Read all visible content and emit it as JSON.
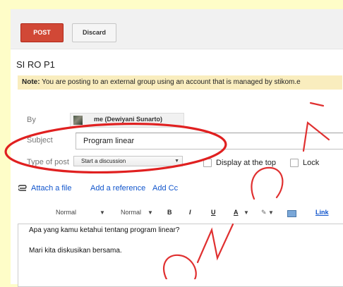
{
  "toolbar": {
    "post_label": "POST",
    "discard_label": "Discard"
  },
  "group_title": "SI RO P1",
  "note": {
    "prefix": "Note:",
    "text": "You are posting to an external group using an account that is managed by stikom.e"
  },
  "form": {
    "by_label": "By",
    "by_value": "me (Dewiyani Sunarto)",
    "subject_label": "Subject",
    "subject_value": "Program linear",
    "type_label": "Type of post",
    "type_value": "Start a discussion",
    "display_top_label": "Display at the top",
    "lock_label": "Lock"
  },
  "attachments": {
    "attach_file": "Attach a file",
    "add_reference": "Add a reference",
    "add_cc": "Add Cc"
  },
  "format_bar": {
    "style": "Normal",
    "size": "Normal",
    "bold": "B",
    "italic": "I",
    "underline": "U",
    "text_color": "A",
    "link": "Link"
  },
  "editor": {
    "line1": "Apa yang kamu ketahui tentang program linear?",
    "line2": "Mari kita diskusikan bersama."
  },
  "colors": {
    "post_button": "#d14836",
    "annotation_circle": "#e02020",
    "watermark": "#e03030"
  },
  "icons": [
    "paperclip-icon",
    "avatar-photo",
    "highlight-icon",
    "image-icon",
    "dropdown-arrow-icon"
  ]
}
